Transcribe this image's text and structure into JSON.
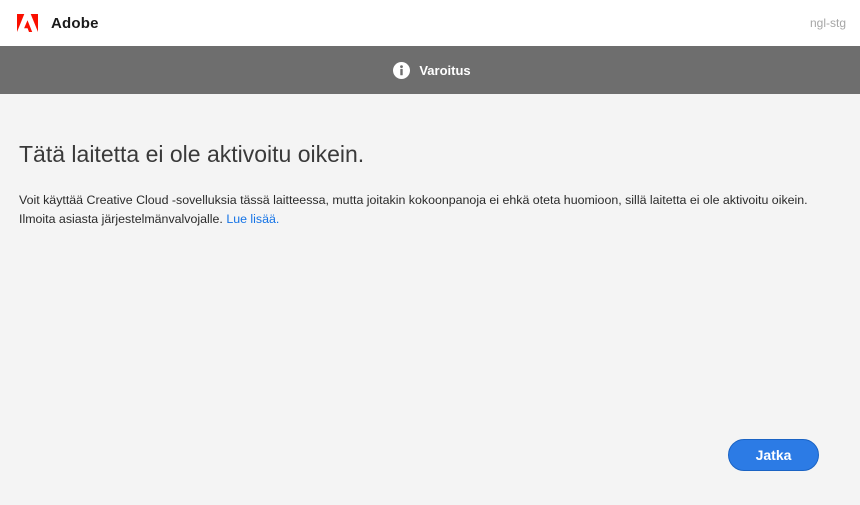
{
  "app": {
    "brand": "Adobe",
    "environment": "ngl-stg",
    "logo_icon": "adobe-logo-icon",
    "brand_color": "#fa0f00"
  },
  "banner": {
    "icon": "info-icon",
    "title": "Varoitus",
    "background": "#6e6e6e"
  },
  "message": {
    "heading": "Tätä laitetta ei ole aktivoitu oikein.",
    "line1": "Voit käyttää Creative Cloud -sovelluksia tässä laitteessa, mutta joitakin kokoonpanoja ei ehkä oteta huomioon, sillä laitetta ei ole aktivoitu oikein.",
    "line2": "Ilmoita asiasta järjestelmänvalvojalle.",
    "link_label": "Lue lisää."
  },
  "actions": {
    "continue_label": "Jatka",
    "accent": "#2c7be5"
  }
}
